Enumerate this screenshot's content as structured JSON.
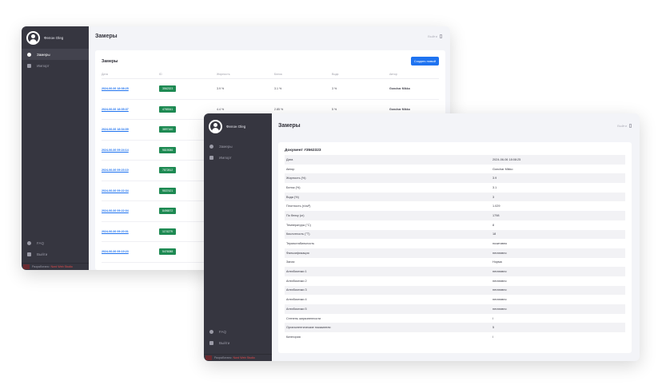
{
  "app": {
    "user_name": "Фелон Oleg",
    "credit_prefix": "Разработано",
    "credit_studio": "Nord Web Studio",
    "logout_top": "Выйти"
  },
  "sidebar": {
    "items": [
      {
        "label": "Замеры"
      },
      {
        "label": "Импорт"
      }
    ],
    "bottom": [
      {
        "label": "FAQ"
      },
      {
        "label": "Выйти"
      }
    ]
  },
  "list_page": {
    "title": "Замеры",
    "card_title": "Замеры",
    "create_button": "Создать новый",
    "columns": [
      "Дата",
      "ID",
      "Жирность",
      "Белок",
      "Вода",
      "Автор"
    ],
    "rows": [
      {
        "date": "2024-06-06 18:08:25",
        "id": "3562323",
        "fat": "3.9 %",
        "protein": "3.1 %",
        "water": "3 %",
        "author": "Gonchar Mikko"
      },
      {
        "date": "2024-06-06 18:05:37",
        "id": "4765341",
        "fat": "4.4 %",
        "protein": "2.85 %",
        "water": "5 %",
        "author": "Gonchar Mikko"
      },
      {
        "date": "2024-06-06 18:04:09",
        "id": "3897160",
        "fat": "",
        "protein": "",
        "water": "",
        "author": ""
      },
      {
        "date": "2024-06-06 09:24:14",
        "id": "9819086",
        "fat": "",
        "protein": "",
        "water": "",
        "author": ""
      },
      {
        "date": "2024-06-06 09:23:10",
        "id": "7872812",
        "fat": "",
        "protein": "",
        "water": "",
        "author": ""
      },
      {
        "date": "2024-06-06 09:22:34",
        "id": "9537421",
        "fat": "",
        "protein": "",
        "water": "",
        "author": ""
      },
      {
        "date": "2024-06-06 09:22:04",
        "id": "8496572",
        "fat": "",
        "protein": "",
        "water": "",
        "author": ""
      },
      {
        "date": "2024-06-06 09:20:01",
        "id": "1174279",
        "fat": "",
        "protein": "",
        "water": "",
        "author": ""
      },
      {
        "date": "2024-06-06 09:19:23",
        "id": "5476088",
        "fat": "",
        "protein": "",
        "water": "",
        "author": ""
      }
    ]
  },
  "detail_page": {
    "title": "Замеры",
    "doc_title": "Документ #3562323",
    "fields": [
      {
        "label": "Дата",
        "value": "2024-06-06 18:08:25"
      },
      {
        "label": "Автор",
        "value": "Gonchar Mikko"
      },
      {
        "label": "Жирность (%)",
        "value": "3.9"
      },
      {
        "label": "Белок (%)",
        "value": "3.1"
      },
      {
        "label": "Вода (%)",
        "value": "3"
      },
      {
        "label": "Плотность (г/см³)",
        "value": "1.029"
      },
      {
        "label": "По белку (кг)",
        "value": "1798"
      },
      {
        "label": "Температура (°C)",
        "value": "8"
      },
      {
        "label": "Кислотность (°T)",
        "value": "18"
      },
      {
        "label": "Термостабильность",
        "value": "позитивно"
      },
      {
        "label": "Фальсификация",
        "value": "негативно"
      },
      {
        "label": "Запах",
        "value": "Норма"
      },
      {
        "label": "Антибиотики 1",
        "value": "негативно"
      },
      {
        "label": "Антибиотики 2",
        "value": "негативно"
      },
      {
        "label": "Антибиотики 3",
        "value": "негативно"
      },
      {
        "label": "Антибиотики 4",
        "value": "негативно"
      },
      {
        "label": "Антибиотики 5",
        "value": "негативно"
      },
      {
        "label": "Степень загрязненности",
        "value": "I"
      },
      {
        "label": "Органолептические показатели",
        "value": "5"
      },
      {
        "label": "Категория",
        "value": "I"
      }
    ]
  }
}
